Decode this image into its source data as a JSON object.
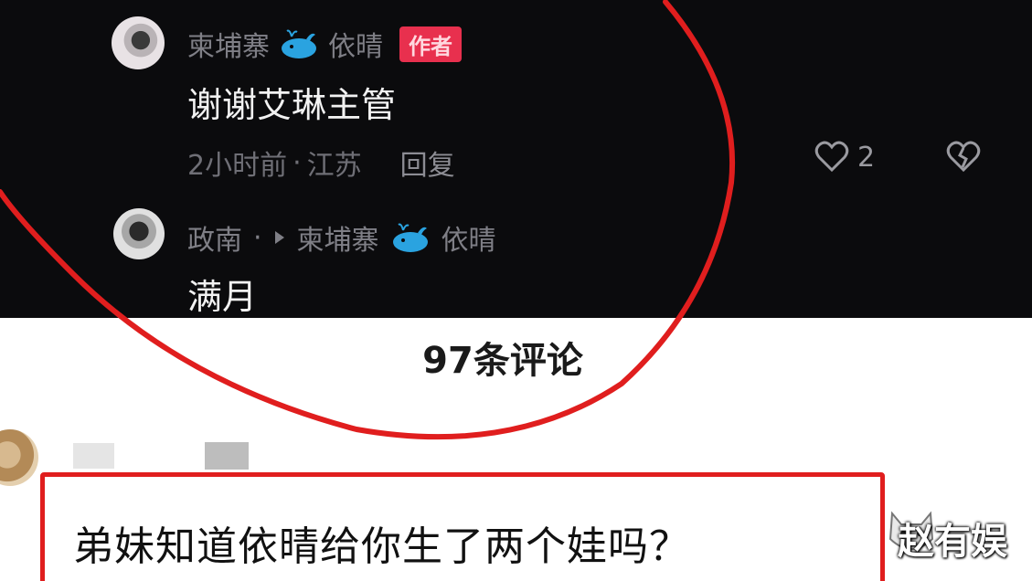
{
  "thread": {
    "comment1": {
      "username": "柬埔寨",
      "username_suffix": "依晴",
      "badge": "作者",
      "text": "谢谢艾琳主管",
      "time": "2小时前",
      "separator": "·",
      "location": "江苏",
      "reply_label": "回复",
      "like_count": "2",
      "icons": [
        "whale-icon",
        "heart-icon",
        "broken-heart-icon"
      ]
    },
    "comment2": {
      "username": "政南",
      "separator": "·",
      "reply_to": "柬埔寨",
      "reply_to_suffix": "依晴",
      "text": "满月",
      "icons": [
        "play-arrow-icon",
        "whale-icon"
      ]
    }
  },
  "comments_header": {
    "count_label": "97条评论"
  },
  "bottom_comment": {
    "text": "弟妹知道依晴给你生了两个娃吗？"
  },
  "watermark": {
    "text": "赵有娱"
  },
  "colors": {
    "dark_bg": "#0b0b0d",
    "badge_bg": "#e8304e",
    "annotation_red": "#e01e1e",
    "whale_blue": "#2aa3e0"
  }
}
